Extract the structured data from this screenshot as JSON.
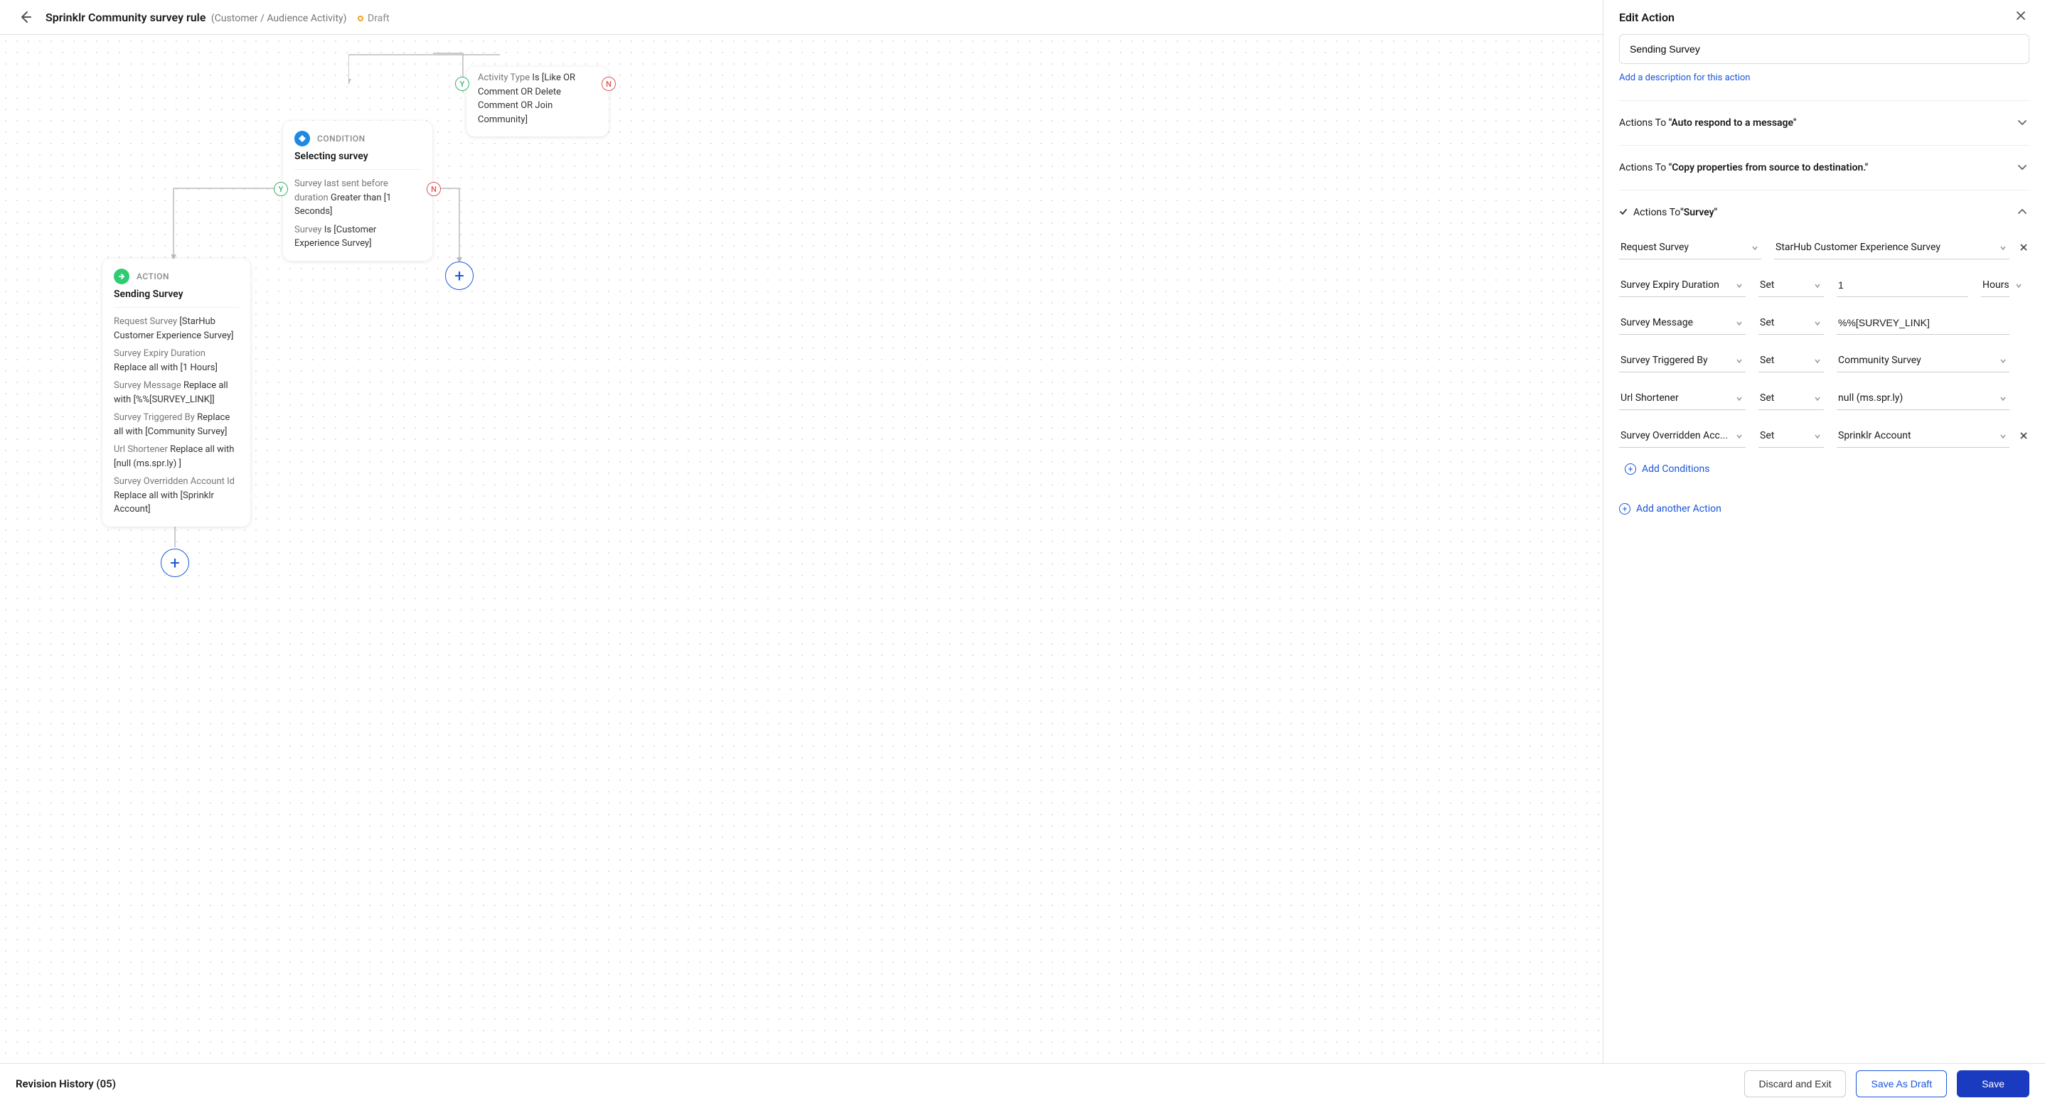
{
  "header": {
    "title": "Sprinklr Community survey rule",
    "subtitle": "(Customer / Audience Activity)",
    "status": "Draft"
  },
  "canvas": {
    "activity_card": {
      "label_prefix": "Activity Type",
      "text": "Is [Like OR Comment OR Delete Comment OR Join Community]"
    },
    "condition_card": {
      "type": "CONDITION",
      "title": "Selecting survey",
      "line1_prefix": "Survey last sent before duration",
      "line1_value": "Greater than [1 Seconds]",
      "line2_prefix": "Survey",
      "line2_value": "Is [Customer Experience Survey]"
    },
    "action_card": {
      "type": "ACTION",
      "title": "Sending Survey",
      "lines": [
        {
          "prefix": "Request Survey",
          "value": "[StarHub Customer Experience Survey]"
        },
        {
          "prefix": "Survey Expiry Duration",
          "value": "Replace all with [1 Hours]"
        },
        {
          "prefix": "Survey Message",
          "value": "Replace all with [%%[SURVEY_LINK]]"
        },
        {
          "prefix": "Survey Triggered By",
          "value": "Replace all with [Community Survey]"
        },
        {
          "prefix": "Url Shortener",
          "value": "Replace all with [null (ms.spr.ly) ]"
        },
        {
          "prefix": "Survey Overridden Account Id",
          "value": "Replace all with [Sprinklr Account]"
        }
      ]
    },
    "badge_y": "Y",
    "badge_n": "N"
  },
  "panel": {
    "title": "Edit Action",
    "name_value": "Sending Survey",
    "add_description": "Add a description for this action",
    "sections": {
      "auto_respond": {
        "prefix": "Actions To ",
        "strong": "\"Auto respond to a message\""
      },
      "copy_props": {
        "prefix": "Actions To ",
        "strong": "\"Copy properties from source to destination.\""
      },
      "survey": {
        "prefix": "Actions To ",
        "strong": "\"Survey\""
      }
    },
    "survey_form": {
      "request_survey_label": "Request Survey",
      "request_survey_value": "StarHub Customer Experience Survey",
      "rows": [
        {
          "field": "Survey Expiry Duration",
          "op": "Set",
          "val1": "1",
          "val2": "Hours"
        },
        {
          "field": "Survey Message",
          "op": "Set",
          "val_text": "%%[SURVEY_LINK]"
        },
        {
          "field": "Survey Triggered By",
          "op": "Set",
          "val_sel": "Community Survey"
        },
        {
          "field": "Url Shortener",
          "op": "Set",
          "val_sel": "null (ms.spr.ly)"
        },
        {
          "field": "Survey Overridden Acc...",
          "op": "Set",
          "val_sel": "Sprinklr Account",
          "removable": true
        }
      ],
      "add_conditions": "Add Conditions",
      "add_another_action": "Add another Action"
    }
  },
  "footer": {
    "revision": "Revision History (05)",
    "discard": "Discard and Exit",
    "save_draft": "Save As Draft",
    "save": "Save"
  }
}
